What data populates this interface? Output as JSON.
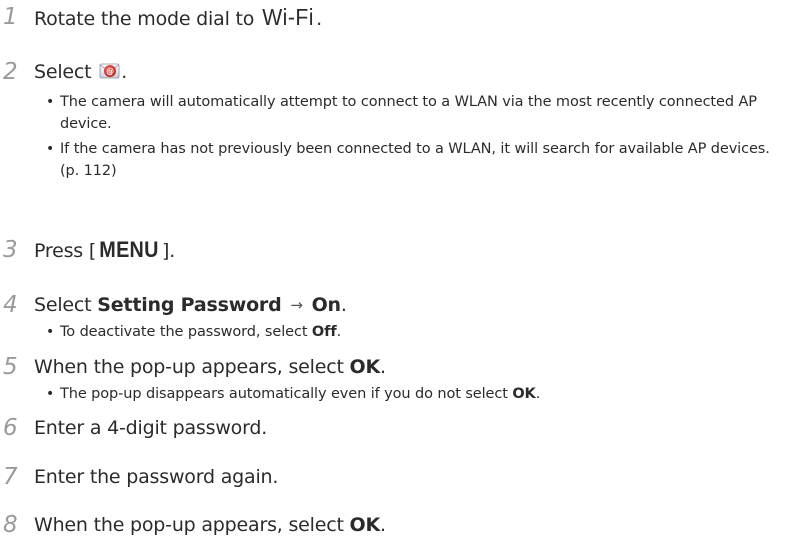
{
  "steps": [
    {
      "num": "1",
      "prefix": "Rotate the mode dial to ",
      "mode_word": "Wi-Fi",
      "suffix": "."
    },
    {
      "num": "2",
      "prefix": "Select ",
      "icon": "email-app-icon",
      "suffix": ".",
      "bullets": [
        "The camera will automatically attempt to connect to a WLAN via the most recently connected AP device.",
        "If the camera has not previously been connected to a WLAN, it will search for available AP devices. (p. 112)"
      ]
    },
    {
      "num": "3",
      "prefix": "Press [",
      "menu_word": "MENU",
      "suffix": "]."
    },
    {
      "num": "4",
      "prefix": "Select ",
      "bold1": "Setting Password",
      "arrow": "→",
      "bold2": "On",
      "suffix": ".",
      "bullets": [
        {
          "prefix": "To deactivate the password, select ",
          "bold": "Off",
          "suffix": "."
        }
      ]
    },
    {
      "num": "5",
      "prefix": "When the pop-up appears, select ",
      "bold1": "OK",
      "suffix": ".",
      "bullets": [
        {
          "prefix": "The pop-up disappears automatically even if you do not select ",
          "bold": "OK",
          "suffix": "."
        }
      ]
    },
    {
      "num": "6",
      "prefix": "Enter a 4-digit password."
    },
    {
      "num": "7",
      "prefix": "Enter the password again."
    },
    {
      "num": "8",
      "prefix": "When the pop-up appears, select ",
      "bold1": "OK",
      "suffix": "."
    }
  ],
  "colors": {
    "step_number": "#9a9a9a",
    "text": "#2b2b2b",
    "icon_red": "#d0302a"
  }
}
